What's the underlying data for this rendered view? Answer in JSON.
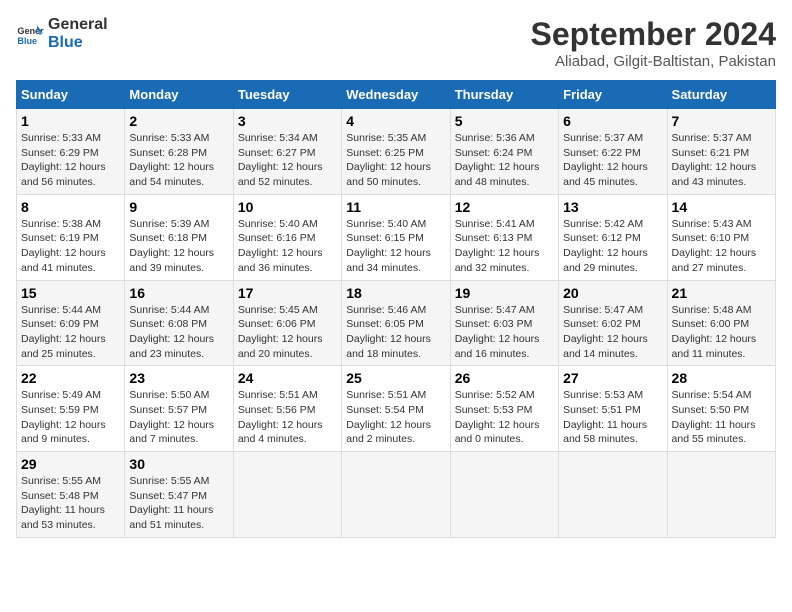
{
  "logo": {
    "line1": "General",
    "line2": "Blue"
  },
  "title": "September 2024",
  "subtitle": "Aliabad, Gilgit-Baltistan, Pakistan",
  "header_row": [
    "Sunday",
    "Monday",
    "Tuesday",
    "Wednesday",
    "Thursday",
    "Friday",
    "Saturday"
  ],
  "weeks": [
    [
      {
        "day": "1",
        "lines": [
          "Sunrise: 5:33 AM",
          "Sunset: 6:29 PM",
          "Daylight: 12 hours",
          "and 56 minutes."
        ]
      },
      {
        "day": "2",
        "lines": [
          "Sunrise: 5:33 AM",
          "Sunset: 6:28 PM",
          "Daylight: 12 hours",
          "and 54 minutes."
        ]
      },
      {
        "day": "3",
        "lines": [
          "Sunrise: 5:34 AM",
          "Sunset: 6:27 PM",
          "Daylight: 12 hours",
          "and 52 minutes."
        ]
      },
      {
        "day": "4",
        "lines": [
          "Sunrise: 5:35 AM",
          "Sunset: 6:25 PM",
          "Daylight: 12 hours",
          "and 50 minutes."
        ]
      },
      {
        "day": "5",
        "lines": [
          "Sunrise: 5:36 AM",
          "Sunset: 6:24 PM",
          "Daylight: 12 hours",
          "and 48 minutes."
        ]
      },
      {
        "day": "6",
        "lines": [
          "Sunrise: 5:37 AM",
          "Sunset: 6:22 PM",
          "Daylight: 12 hours",
          "and 45 minutes."
        ]
      },
      {
        "day": "7",
        "lines": [
          "Sunrise: 5:37 AM",
          "Sunset: 6:21 PM",
          "Daylight: 12 hours",
          "and 43 minutes."
        ]
      }
    ],
    [
      {
        "day": "8",
        "lines": [
          "Sunrise: 5:38 AM",
          "Sunset: 6:19 PM",
          "Daylight: 12 hours",
          "and 41 minutes."
        ]
      },
      {
        "day": "9",
        "lines": [
          "Sunrise: 5:39 AM",
          "Sunset: 6:18 PM",
          "Daylight: 12 hours",
          "and 39 minutes."
        ]
      },
      {
        "day": "10",
        "lines": [
          "Sunrise: 5:40 AM",
          "Sunset: 6:16 PM",
          "Daylight: 12 hours",
          "and 36 minutes."
        ]
      },
      {
        "day": "11",
        "lines": [
          "Sunrise: 5:40 AM",
          "Sunset: 6:15 PM",
          "Daylight: 12 hours",
          "and 34 minutes."
        ]
      },
      {
        "day": "12",
        "lines": [
          "Sunrise: 5:41 AM",
          "Sunset: 6:13 PM",
          "Daylight: 12 hours",
          "and 32 minutes."
        ]
      },
      {
        "day": "13",
        "lines": [
          "Sunrise: 5:42 AM",
          "Sunset: 6:12 PM",
          "Daylight: 12 hours",
          "and 29 minutes."
        ]
      },
      {
        "day": "14",
        "lines": [
          "Sunrise: 5:43 AM",
          "Sunset: 6:10 PM",
          "Daylight: 12 hours",
          "and 27 minutes."
        ]
      }
    ],
    [
      {
        "day": "15",
        "lines": [
          "Sunrise: 5:44 AM",
          "Sunset: 6:09 PM",
          "Daylight: 12 hours",
          "and 25 minutes."
        ]
      },
      {
        "day": "16",
        "lines": [
          "Sunrise: 5:44 AM",
          "Sunset: 6:08 PM",
          "Daylight: 12 hours",
          "and 23 minutes."
        ]
      },
      {
        "day": "17",
        "lines": [
          "Sunrise: 5:45 AM",
          "Sunset: 6:06 PM",
          "Daylight: 12 hours",
          "and 20 minutes."
        ]
      },
      {
        "day": "18",
        "lines": [
          "Sunrise: 5:46 AM",
          "Sunset: 6:05 PM",
          "Daylight: 12 hours",
          "and 18 minutes."
        ]
      },
      {
        "day": "19",
        "lines": [
          "Sunrise: 5:47 AM",
          "Sunset: 6:03 PM",
          "Daylight: 12 hours",
          "and 16 minutes."
        ]
      },
      {
        "day": "20",
        "lines": [
          "Sunrise: 5:47 AM",
          "Sunset: 6:02 PM",
          "Daylight: 12 hours",
          "and 14 minutes."
        ]
      },
      {
        "day": "21",
        "lines": [
          "Sunrise: 5:48 AM",
          "Sunset: 6:00 PM",
          "Daylight: 12 hours",
          "and 11 minutes."
        ]
      }
    ],
    [
      {
        "day": "22",
        "lines": [
          "Sunrise: 5:49 AM",
          "Sunset: 5:59 PM",
          "Daylight: 12 hours",
          "and 9 minutes."
        ]
      },
      {
        "day": "23",
        "lines": [
          "Sunrise: 5:50 AM",
          "Sunset: 5:57 PM",
          "Daylight: 12 hours",
          "and 7 minutes."
        ]
      },
      {
        "day": "24",
        "lines": [
          "Sunrise: 5:51 AM",
          "Sunset: 5:56 PM",
          "Daylight: 12 hours",
          "and 4 minutes."
        ]
      },
      {
        "day": "25",
        "lines": [
          "Sunrise: 5:51 AM",
          "Sunset: 5:54 PM",
          "Daylight: 12 hours",
          "and 2 minutes."
        ]
      },
      {
        "day": "26",
        "lines": [
          "Sunrise: 5:52 AM",
          "Sunset: 5:53 PM",
          "Daylight: 12 hours",
          "and 0 minutes."
        ]
      },
      {
        "day": "27",
        "lines": [
          "Sunrise: 5:53 AM",
          "Sunset: 5:51 PM",
          "Daylight: 11 hours",
          "and 58 minutes."
        ]
      },
      {
        "day": "28",
        "lines": [
          "Sunrise: 5:54 AM",
          "Sunset: 5:50 PM",
          "Daylight: 11 hours",
          "and 55 minutes."
        ]
      }
    ],
    [
      {
        "day": "29",
        "lines": [
          "Sunrise: 5:55 AM",
          "Sunset: 5:48 PM",
          "Daylight: 11 hours",
          "and 53 minutes."
        ]
      },
      {
        "day": "30",
        "lines": [
          "Sunrise: 5:55 AM",
          "Sunset: 5:47 PM",
          "Daylight: 11 hours",
          "and 51 minutes."
        ]
      },
      null,
      null,
      null,
      null,
      null
    ]
  ]
}
